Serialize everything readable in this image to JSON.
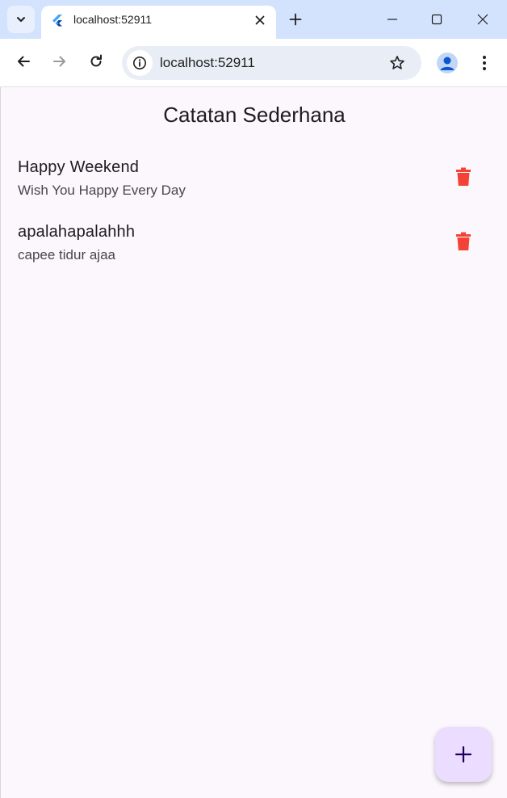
{
  "browser": {
    "tab": {
      "title": "localhost:52911"
    },
    "address_bar": {
      "url": "localhost:52911"
    },
    "icons": {
      "tab_search": "chevron-down-icon",
      "favicon": "flutter-icon",
      "tab_close": "close-icon",
      "new_tab": "plus-icon",
      "minimize": "minimize-icon",
      "maximize": "maximize-icon",
      "close_window": "close-icon",
      "back": "arrow-left-icon",
      "forward": "arrow-right-icon",
      "reload": "reload-icon",
      "site_info": "info-icon",
      "bookmark": "star-icon",
      "profile": "avatar-icon",
      "menu": "more-vert-icon"
    }
  },
  "app": {
    "title": "Catatan Sederhana",
    "notes": [
      {
        "title": "Happy Weekend",
        "content": "Wish You Happy Every Day"
      },
      {
        "title": "apalahapalahhh",
        "content": "capee tidur ajaa"
      }
    ],
    "delete_icon": "trash-icon",
    "delete_color": "#f44336",
    "fab_icon": "plus-icon",
    "fab_color": "#eaddff"
  }
}
